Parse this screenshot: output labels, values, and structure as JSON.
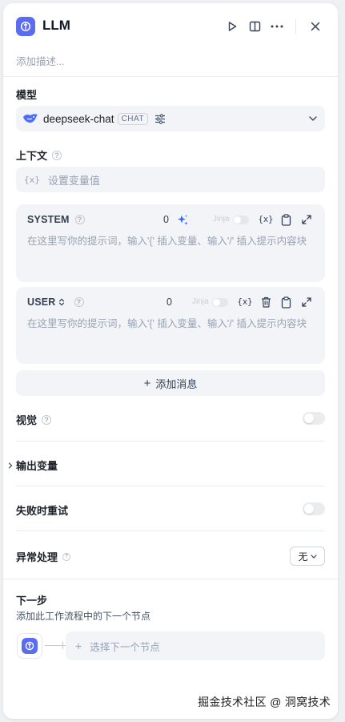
{
  "header": {
    "title": "LLM",
    "description_placeholder": "添加描述..."
  },
  "model": {
    "label": "模型",
    "name": "deepseek-chat",
    "mode_tag": "CHAT"
  },
  "context": {
    "label": "上下文",
    "var_symbol": "{x}",
    "placeholder": "设置变量值"
  },
  "prompts": [
    {
      "role": "SYSTEM",
      "count": "0",
      "jinja_label": "Jinja",
      "var_symbol": "{x}",
      "placeholder": "在这里写你的提示词，输入'{' 插入变量、输入'/' 插入提示内容块"
    },
    {
      "role": "USER",
      "count": "0",
      "jinja_label": "Jinja",
      "var_symbol": "{x}",
      "placeholder": "在这里写你的提示词，输入'{' 插入变量、输入'/' 插入提示内容块"
    }
  ],
  "add_message_label": "添加消息",
  "vision": {
    "label": "视觉",
    "enabled": false
  },
  "output_vars": {
    "label": "输出变量"
  },
  "retry": {
    "label": "失败时重试",
    "enabled": false
  },
  "error_handling": {
    "label": "异常处理",
    "value": "无"
  },
  "next_step": {
    "label": "下一步",
    "subtitle": "添加此工作流程中的下一个节点",
    "select_placeholder": "选择下一个节点"
  },
  "watermark": "掘金技术社区 @ 洞窝技术",
  "colors": {
    "accent": "#5b6cf0",
    "surface": "#f2f4f7",
    "sparkle": "#2f6bff"
  }
}
